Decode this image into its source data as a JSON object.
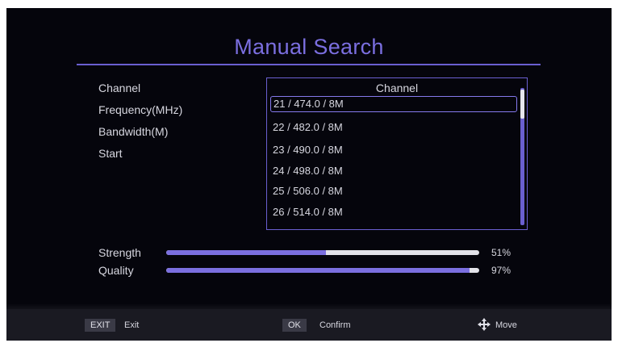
{
  "header": {
    "title": "Manual Search"
  },
  "fields": [
    {
      "label": "Channel"
    },
    {
      "label": "Frequency(MHz)"
    },
    {
      "label": "Bandwidth(M)"
    },
    {
      "label": "Start"
    }
  ],
  "channel_list": {
    "header": "Channel",
    "items": [
      {
        "label": "21 / 474.0 / 8M",
        "selected": true
      },
      {
        "label": "22 / 482.0 / 8M",
        "selected": false
      },
      {
        "label": "23 / 490.0 / 8M",
        "selected": false
      },
      {
        "label": "24 / 498.0 / 8M",
        "selected": false
      },
      {
        "label": "25 / 506.0 / 8M",
        "selected": false
      },
      {
        "label": "26 / 514.0 / 8M",
        "selected": false
      }
    ]
  },
  "signal": {
    "strength": {
      "label": "Strength",
      "value": 51,
      "display": "51%"
    },
    "quality": {
      "label": "Quality",
      "value": 97,
      "display": "97%"
    }
  },
  "footer": {
    "exit_key": "EXIT",
    "exit_label": "Exit",
    "ok_key": "OK",
    "ok_label": "Confirm",
    "move_icon": "move-arrows-icon",
    "move_label": "Move"
  },
  "colors": {
    "accent": "#7b6fe0",
    "background": "#05050c",
    "text": "#d7d7e0",
    "bar_track": "#e3e3ea"
  }
}
